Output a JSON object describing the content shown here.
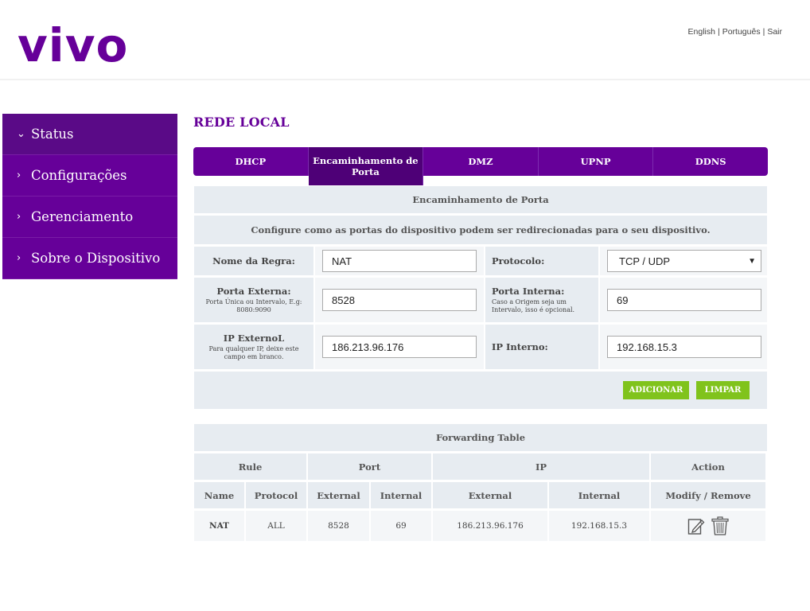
{
  "brand": {
    "logo_text": "vivo",
    "accent": "#660099",
    "button_color": "#80c31c"
  },
  "top_links": {
    "english": "English",
    "portugues": "Português",
    "logout": "Sair",
    "separator": "|"
  },
  "sidebar": {
    "items": [
      {
        "label": "Status",
        "chevron": "chevron-down-icon",
        "active": true
      },
      {
        "label": "Configurações",
        "chevron": "chevron-right-icon"
      },
      {
        "label": "Gerenciamento",
        "chevron": "chevron-right-icon"
      },
      {
        "label": "Sobre o Dispositivo",
        "chevron": "chevron-right-icon"
      }
    ]
  },
  "page": {
    "title": "REDE LOCAL"
  },
  "tabs": [
    {
      "label": "DHCP"
    },
    {
      "label": "Encaminhamento de Porta",
      "active": true
    },
    {
      "label": "DMZ"
    },
    {
      "label": "UPNP"
    },
    {
      "label": "DDNS"
    }
  ],
  "form": {
    "section_title": "Encaminhamento de Porta",
    "description": "Configure como as portas do dispositivo podem ser redirecionadas para o seu dispositivo.",
    "rule_name": {
      "label": "Nome da Regra:",
      "value": "NAT"
    },
    "protocol": {
      "label": "Protocolo:",
      "value": "TCP / UDP"
    },
    "external_port": {
      "label": "Porta Externa:",
      "hint": "Porta Única ou Intervalo, E.g: 8080:9090",
      "value": "8528"
    },
    "internal_port": {
      "label": "Porta Interna:",
      "hint": "Caso a Origem seja um Intervalo, isso é opcional.",
      "value": "69"
    },
    "external_ip": {
      "label": "IP ExternoL",
      "hint": "Para qualquer IP, deixe este campo em branco.",
      "value": "186.213.96.176"
    },
    "internal_ip": {
      "label": "IP Interno:",
      "value": "192.168.15.3"
    },
    "add_label": "ADICIONAR",
    "clear_label": "LIMPAR"
  },
  "table": {
    "title": "Forwarding Table",
    "group_headers": {
      "rule": "Rule",
      "port": "Port",
      "ip": "IP",
      "action": "Action"
    },
    "sub_headers": {
      "name": "Name",
      "protocol": "Protocol",
      "port_external": "External",
      "port_internal": "Internal",
      "ip_external": "External",
      "ip_internal": "Internal",
      "modify_remove": "Modify / Remove"
    },
    "rows": [
      {
        "name": "NAT",
        "protocol": "ALL",
        "port_external": "8528",
        "port_internal": "69",
        "ip_external": "186.213.96.176",
        "ip_internal": "192.168.15.3"
      }
    ]
  }
}
